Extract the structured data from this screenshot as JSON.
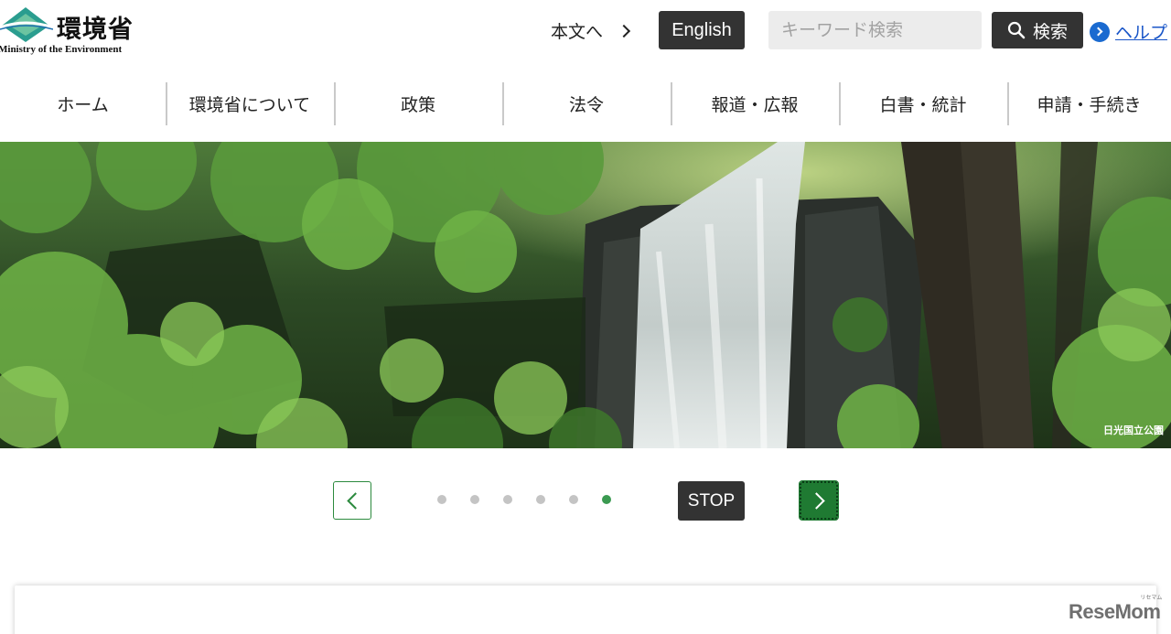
{
  "logo": {
    "jp_name": "環境省",
    "en_name": "Ministry of the Environment"
  },
  "header": {
    "skip_link_label": "本文へ",
    "english_label": "English",
    "search_placeholder": "キーワード検索",
    "search_button_label": "検索",
    "help_label": "ヘルプ"
  },
  "gnav": {
    "items": [
      {
        "label": "ホーム"
      },
      {
        "label": "環境省について"
      },
      {
        "label": "政策"
      },
      {
        "label": "法令"
      },
      {
        "label": "報道・広報"
      },
      {
        "label": "白書・統計"
      },
      {
        "label": "申請・手続き"
      }
    ]
  },
  "hero": {
    "caption": "日光国立公園"
  },
  "carousel": {
    "stop_label": "STOP",
    "slide_count": 6,
    "active_slide": 6
  },
  "watermark": {
    "text": "ReseMom",
    "sub": "リセマム"
  },
  "colors": {
    "accent_green": "#1f7a32",
    "dark_button": "#333333",
    "link_blue": "#1a56c8"
  }
}
